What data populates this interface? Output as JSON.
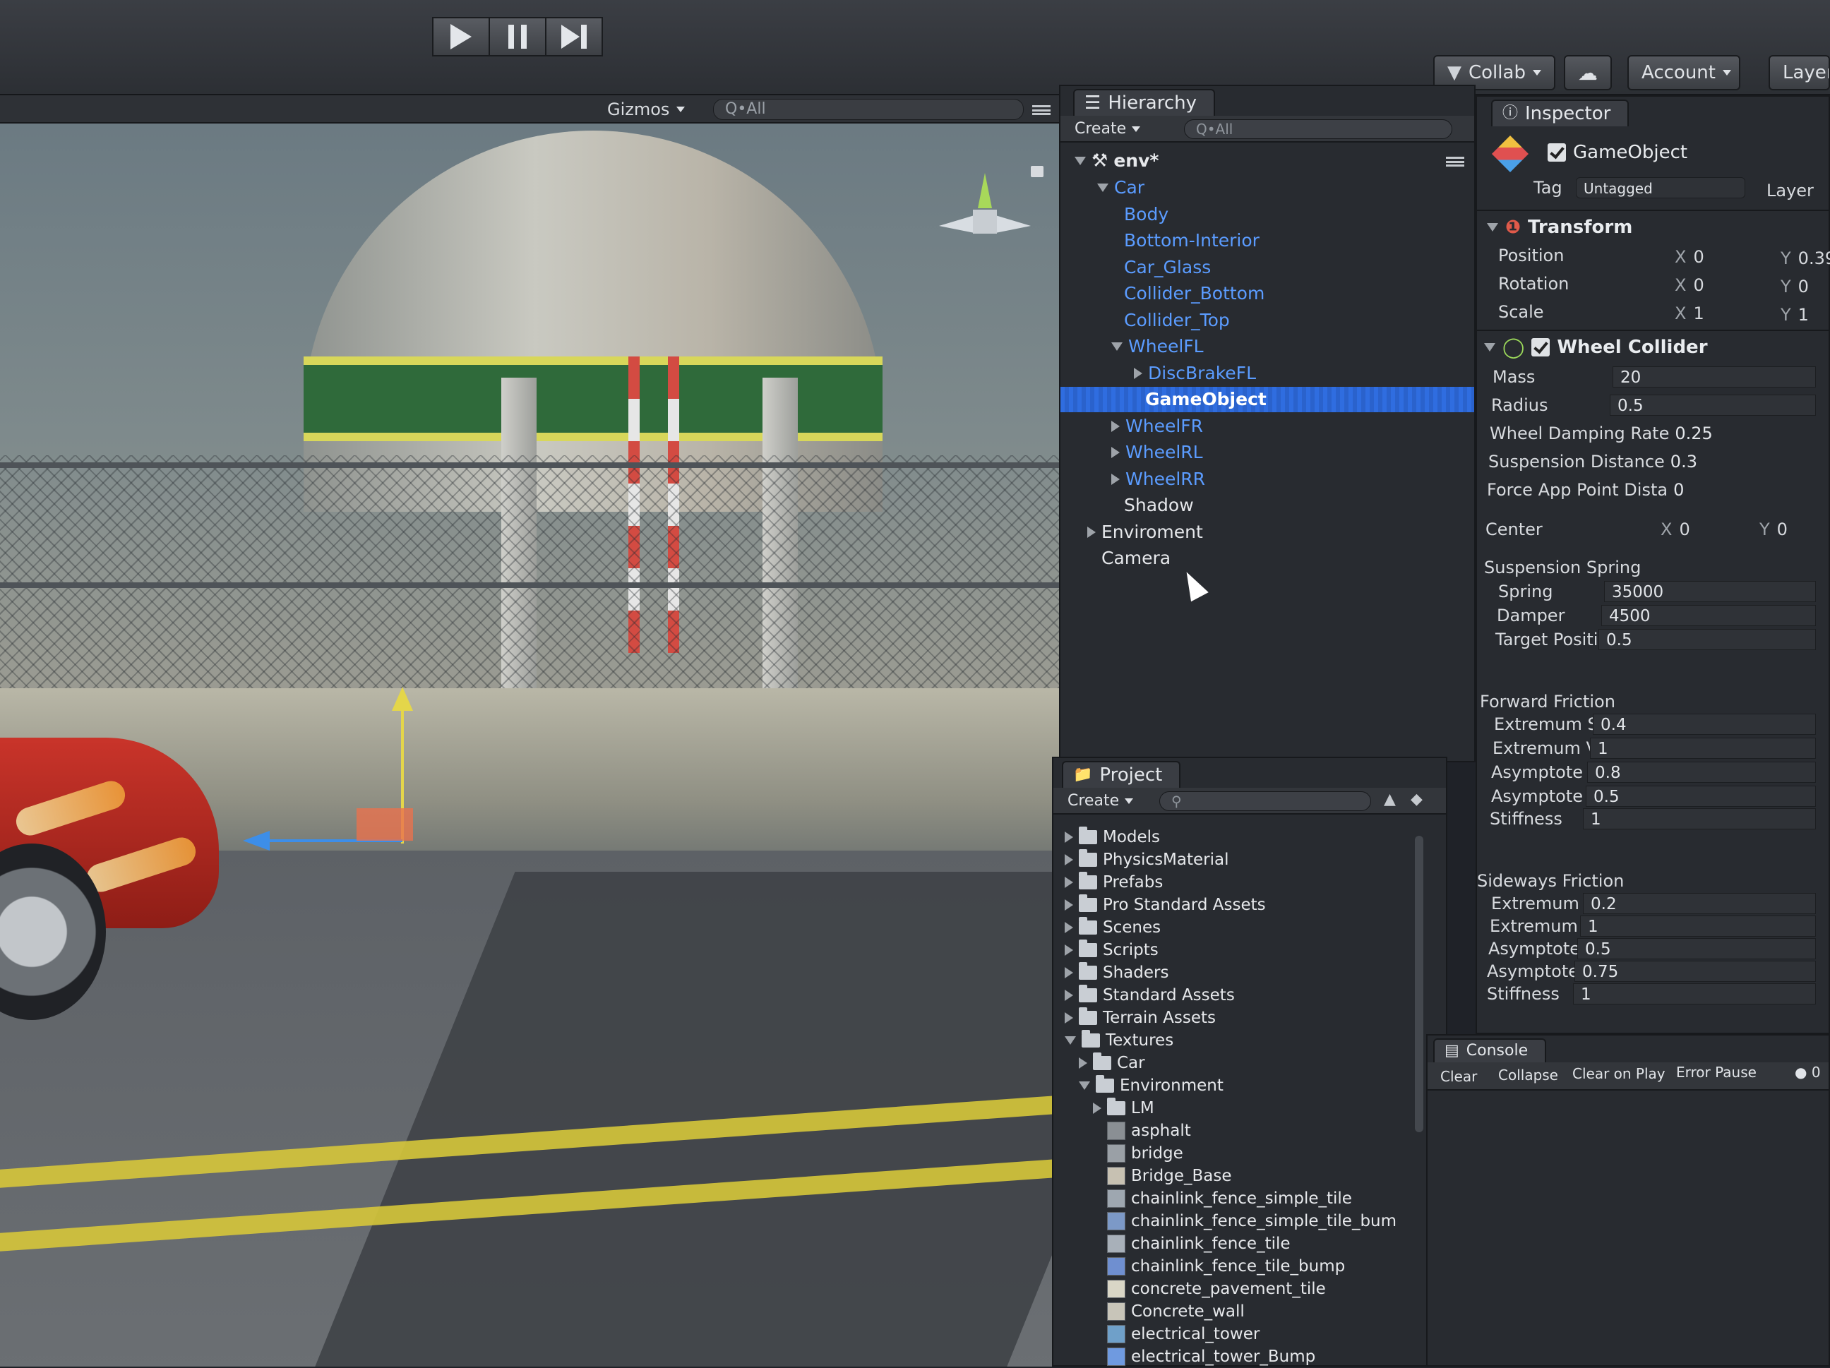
{
  "toolbar": {
    "play_icon": "play-icon",
    "pause_icon": "pause-icon",
    "step_icon": "step-icon",
    "collab_label": "Collab",
    "account_label": "Account",
    "layers_label": "Layers"
  },
  "scene": {
    "gizmos_label": "Gizmos",
    "search_placeholder": "Q•All"
  },
  "hierarchy": {
    "tab_label": "Hierarchy",
    "create_label": "Create",
    "search_placeholder": "Q•All",
    "scene_name": "env*",
    "items": [
      {
        "label": "Car",
        "color": "blue"
      },
      {
        "label": "Body",
        "color": "blue"
      },
      {
        "label": "Bottom-Interior",
        "color": "blue"
      },
      {
        "label": "Car_Glass",
        "color": "blue"
      },
      {
        "label": "Collider_Bottom",
        "color": "blue"
      },
      {
        "label": "Collider_Top",
        "color": "blue"
      },
      {
        "label": "WheelFL",
        "color": "blue"
      },
      {
        "label": "DiscBrakeFL",
        "color": "blue"
      },
      {
        "label": "GameObject",
        "color": "selected"
      },
      {
        "label": "WheelFR",
        "color": "blue"
      },
      {
        "label": "WheelRL",
        "color": "blue"
      },
      {
        "label": "WheelRR",
        "color": "blue"
      },
      {
        "label": "Shadow",
        "color": "white"
      },
      {
        "label": "Enviroment",
        "color": "white"
      },
      {
        "label": "Camera",
        "color": "white"
      }
    ]
  },
  "project": {
    "tab_label": "Project",
    "create_label": "Create",
    "items": [
      {
        "label": "Models",
        "type": "folder"
      },
      {
        "label": "PhysicsMaterial",
        "type": "folder"
      },
      {
        "label": "Prefabs",
        "type": "folder"
      },
      {
        "label": "Pro Standard Assets",
        "type": "folder"
      },
      {
        "label": "Scenes",
        "type": "folder"
      },
      {
        "label": "Scripts",
        "type": "folder"
      },
      {
        "label": "Shaders",
        "type": "folder"
      },
      {
        "label": "Standard Assets",
        "type": "folder"
      },
      {
        "label": "Terrain Assets",
        "type": "folder"
      },
      {
        "label": "Textures",
        "type": "folder"
      },
      {
        "label": "Car",
        "type": "folder"
      },
      {
        "label": "Environment",
        "type": "folder"
      },
      {
        "label": "LM",
        "type": "folder"
      },
      {
        "label": "asphalt",
        "type": "texture"
      },
      {
        "label": "bridge",
        "type": "texture"
      },
      {
        "label": "Bridge_Base",
        "type": "texture"
      },
      {
        "label": "chainlink_fence_simple_tile",
        "type": "texture"
      },
      {
        "label": "chainlink_fence_simple_tile_bum",
        "type": "texture"
      },
      {
        "label": "chainlink_fence_tile",
        "type": "texture"
      },
      {
        "label": "chainlink_fence_tile_bump",
        "type": "texture"
      },
      {
        "label": "concrete_pavement_tile",
        "type": "texture"
      },
      {
        "label": "Concrete_wall",
        "type": "texture"
      },
      {
        "label": "electrical_tower",
        "type": "texture"
      },
      {
        "label": "electrical_tower_Bump",
        "type": "texture"
      }
    ]
  },
  "inspector": {
    "tab_label": "Inspector",
    "object_name": "GameObject",
    "tag_label": "Tag",
    "tag_value": "Untagged",
    "layer_label": "Layer",
    "transform": {
      "title": "Transform",
      "position_label": "Position",
      "position_x": "0",
      "position_y": "0.39",
      "rotation_label": "Rotation",
      "rotation_x": "0",
      "rotation_y": "0",
      "scale_label": "Scale",
      "scale_x": "1",
      "scale_y": "1"
    },
    "wheel_collider": {
      "title": "Wheel Collider",
      "mass_label": "Mass",
      "mass_value": "20",
      "radius_label": "Radius",
      "radius_value": "0.5",
      "damping_label": "Wheel Damping Rate",
      "damping_value": "0.25",
      "suspension_distance_label": "Suspension Distance",
      "suspension_distance_value": "0.3",
      "force_app_label": "Force App Point Dista",
      "force_app_value": "0",
      "center_label": "Center",
      "center_x": "0",
      "center_y": "0",
      "suspension_spring_label": "Suspension Spring",
      "spring_label": "Spring",
      "spring_value": "35000",
      "damper_label": "Damper",
      "damper_value": "4500",
      "target_position_label": "Target Position",
      "target_position_value": "0.5",
      "forward_friction_label": "Forward Friction",
      "ff_extremum_slip_label": "Extremum Slip",
      "ff_extremum_slip_value": "0.4",
      "ff_extremum_value_label": "Extremum Value",
      "ff_extremum_value_value": "1",
      "ff_asymptote_slip_label": "Asymptote Slip",
      "ff_asymptote_slip_value": "0.8",
      "ff_asymptote_value_label": "Asymptote Value",
      "ff_asymptote_value_value": "0.5",
      "ff_stiffness_label": "Stiffness",
      "ff_stiffness_value": "1",
      "sideways_friction_label": "Sideways Friction",
      "sf_extremum_slip_label": "Extremum Slip",
      "sf_extremum_slip_value": "0.2",
      "sf_extremum_value_label": "Extremum Value",
      "sf_extremum_value_value": "1",
      "sf_asymptote_slip_label": "Asymptote Slip",
      "sf_asymptote_slip_value": "0.5",
      "sf_asymptote_value_label": "Asymptote Value",
      "sf_asymptote_value_value": "0.75",
      "sf_stiffness_label": "Stiffness",
      "sf_stiffness_value": "1"
    }
  },
  "console": {
    "tab_label": "Console",
    "clear_label": "Clear",
    "collapse_label": "Collapse",
    "clear_on_play_label": "Clear on Play",
    "error_pause_label": "Error Pause",
    "count": "0"
  },
  "axis_labels": {
    "x": "X",
    "y": "Y"
  }
}
